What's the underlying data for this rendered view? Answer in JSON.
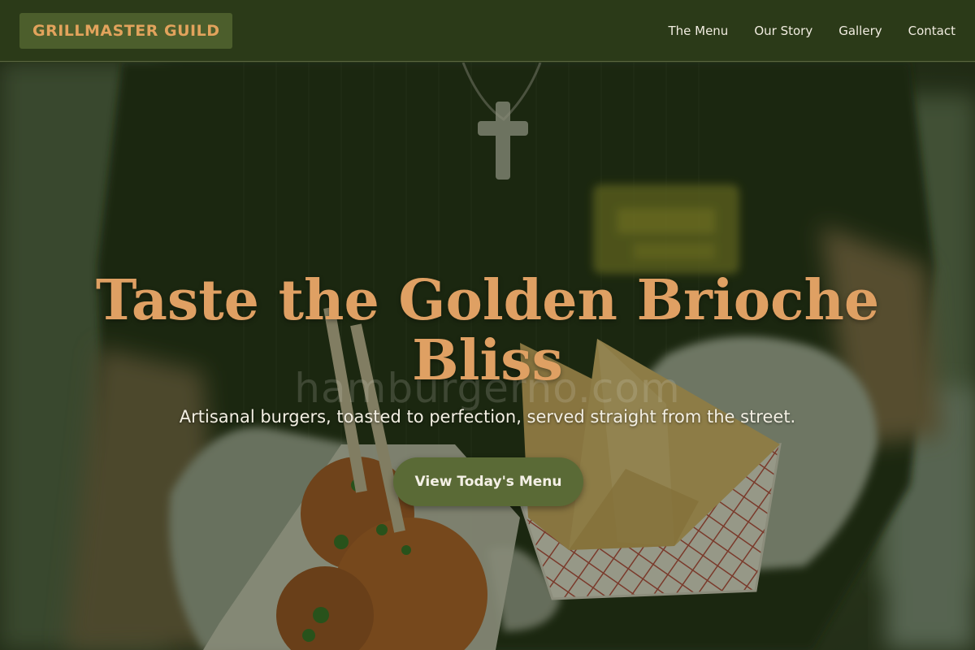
{
  "header": {
    "logo_text": "GRILLMASTER GUILD",
    "nav": [
      "The Menu",
      "Our Story",
      "Gallery",
      "Contact"
    ]
  },
  "hero": {
    "headline": "Taste the Golden Brioche Bliss",
    "watermark": "hamburgerno.com",
    "subheadline": "Artisanal burgers, toasted to perfection, served straight from the street.",
    "cta_label": "View Today's Menu"
  },
  "colors": {
    "header_bg": "#2b3a18",
    "logo_bg": "#4c5e2c",
    "accent_gold": "#dfa063",
    "button_bg": "#5a6a36"
  }
}
